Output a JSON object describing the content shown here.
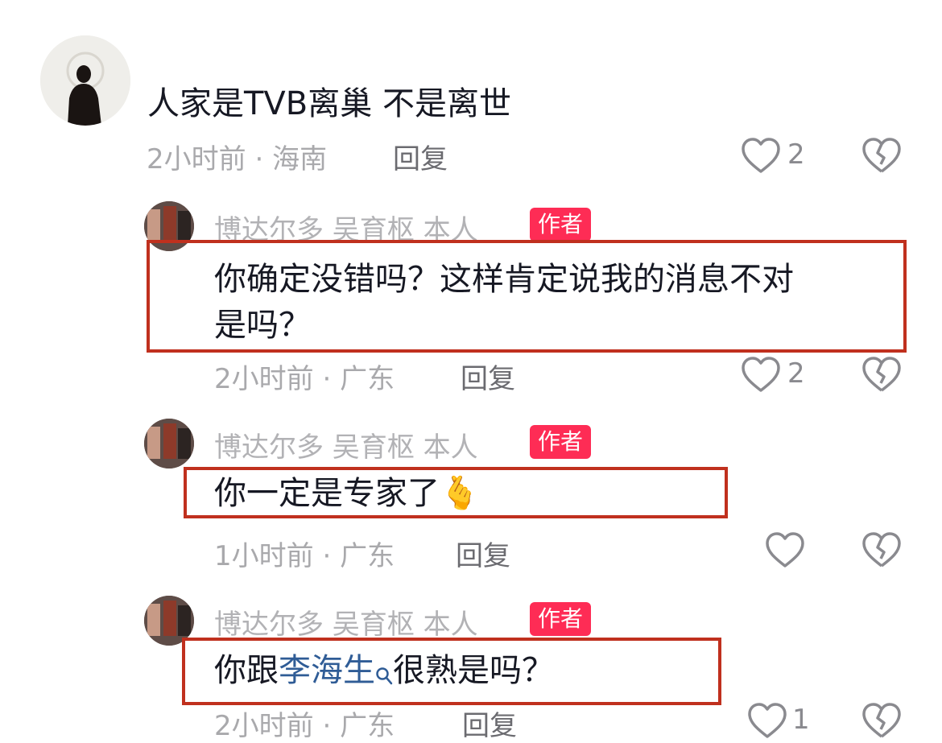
{
  "colors": {
    "badge": "#fe2c55",
    "highlight_border": "#c0301e",
    "link": "#2f5c96"
  },
  "icons": {
    "like": "heart-outline-icon",
    "dislike": "broken-heart-icon",
    "search": "search-icon"
  },
  "top_comment": {
    "text": "人家是TVB离巢  不是离世",
    "time": "2小时前",
    "location": "海南",
    "reply_label": "回复",
    "like_count": "2"
  },
  "replies": [
    {
      "username": "博达尔多 吴育枢 本人",
      "badge": "作者",
      "text_line1": "你确定没错吗？这样肯定说我的消息不对",
      "text_line2": "是吗？",
      "time": "2小时前",
      "location": "广东",
      "reply_label": "回复",
      "like_count": "2"
    },
    {
      "username": "博达尔多 吴育枢 本人",
      "badge": "作者",
      "text": "你一定是专家了",
      "emoji": "🫰",
      "time": "1小时前",
      "location": "广东",
      "reply_label": "回复",
      "like_count": ""
    },
    {
      "username": "博达尔多 吴育枢 本人",
      "badge": "作者",
      "text_before": "你跟",
      "link_text": "李海生",
      "text_after": "很熟是吗？",
      "time": "2小时前",
      "location": "广东",
      "reply_label": "回复",
      "like_count": "1"
    }
  ]
}
